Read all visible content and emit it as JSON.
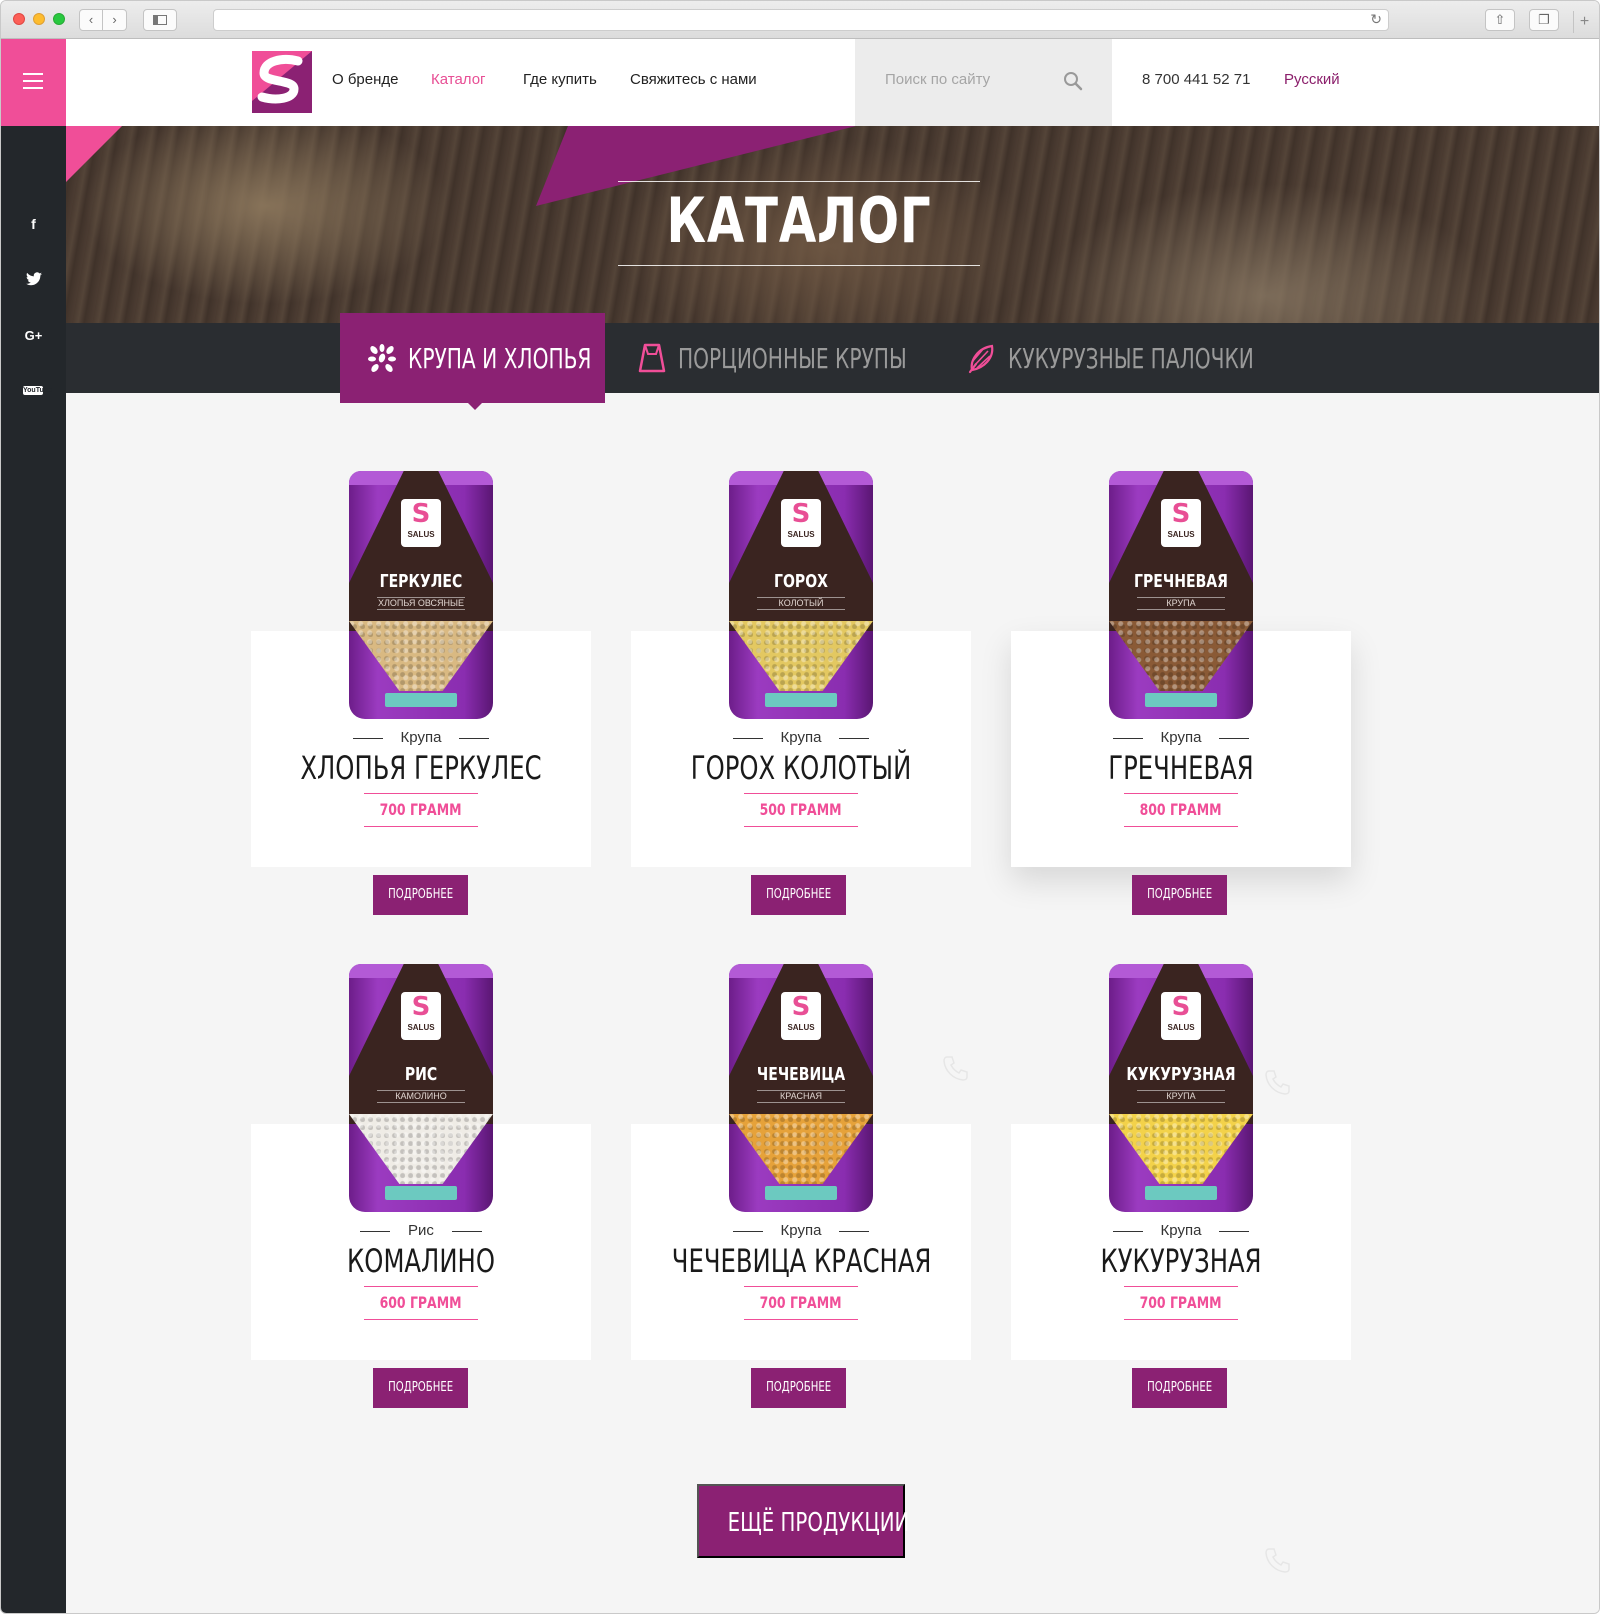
{
  "site": {
    "brand_colors": {
      "pink": "#f04e98",
      "purple": "#8b2173",
      "dark": "#23272b"
    },
    "header": {
      "nav": [
        {
          "label": "О бренде",
          "active": false
        },
        {
          "label": "Каталог",
          "active": true
        },
        {
          "label": "Где купить",
          "active": false
        },
        {
          "label": "Свяжитесь с нами",
          "active": false
        }
      ],
      "search_placeholder": "Поиск по сайту",
      "phone": "8 700 441 52 71",
      "language": "Русский"
    },
    "social": [
      "facebook-icon",
      "twitter-icon",
      "google-plus-icon",
      "youtube-icon"
    ],
    "social_labels": {
      "facebook": "f",
      "google": "G+",
      "youtube": "YouTube"
    },
    "hero": {
      "title": "КАТАЛОГ"
    },
    "tabs": [
      {
        "label": "КРУПА И ХЛОПЬЯ",
        "icon": "grains-icon",
        "active": true
      },
      {
        "label": "ПОРЦИОННЫЕ КРУПЫ",
        "icon": "bag-icon",
        "active": false
      },
      {
        "label": "КУКУРУЗНЫЕ ПАЛОЧКИ",
        "icon": "corn-icon",
        "active": false
      }
    ],
    "products": [
      {
        "category": "Крупа",
        "title": "ХЛОПЬЯ ГЕРКУЛЕС",
        "weight": "700 ГРАММ",
        "button": "ПОДРОБНЕЕ",
        "pack_brand": "SALUS",
        "pack_name": "ГЕРКУЛЕС",
        "pack_sub": "ХЛОПЬЯ ОВСЯНЫЕ",
        "grain_color": "#d9b982"
      },
      {
        "category": "Крупа",
        "title": "ГОРОХ КОЛОТЫЙ",
        "weight": "500 ГРАММ",
        "button": "ПОДРОБНЕЕ",
        "pack_brand": "SALUS",
        "pack_name": "ГОРОХ",
        "pack_sub": "КОЛОТЫЙ",
        "grain_color": "#e3c861"
      },
      {
        "category": "Крупа",
        "title": "ГРЕЧНЕВАЯ",
        "weight": "800 ГРАММ",
        "button": "ПОДРОБНЕЕ",
        "pack_brand": "SALUS",
        "pack_name": "ГРЕЧНЕВАЯ",
        "pack_sub": "КРУПА",
        "grain_color": "#8a5a36"
      },
      {
        "category": "Рис",
        "title": "КОМАЛИНО",
        "weight": "600 ГРАММ",
        "button": "ПОДРОБНЕЕ",
        "pack_brand": "SALUS",
        "pack_name": "РИС",
        "pack_sub": "КАМОЛИНО",
        "grain_color": "#efece6"
      },
      {
        "category": "Крупа",
        "title": "ЧЕЧЕВИЦА КРАСНАЯ",
        "weight": "700 ГРАММ",
        "button": "ПОДРОБНЕЕ",
        "pack_brand": "SALUS",
        "pack_name": "ЧЕЧЕВИЦА",
        "pack_sub": "КРАСНАЯ",
        "grain_color": "#e6a23a"
      },
      {
        "category": "Крупа",
        "title": "КУКУРУЗНАЯ",
        "weight": "700 ГРАММ",
        "button": "ПОДРОБНЕЕ",
        "pack_brand": "SALUS",
        "pack_name": "КУКУРУЗНАЯ",
        "pack_sub": "КРУПА",
        "grain_color": "#f3d24a"
      }
    ],
    "more_button": "ЕЩЁ ПРОДУКЦИИ"
  }
}
